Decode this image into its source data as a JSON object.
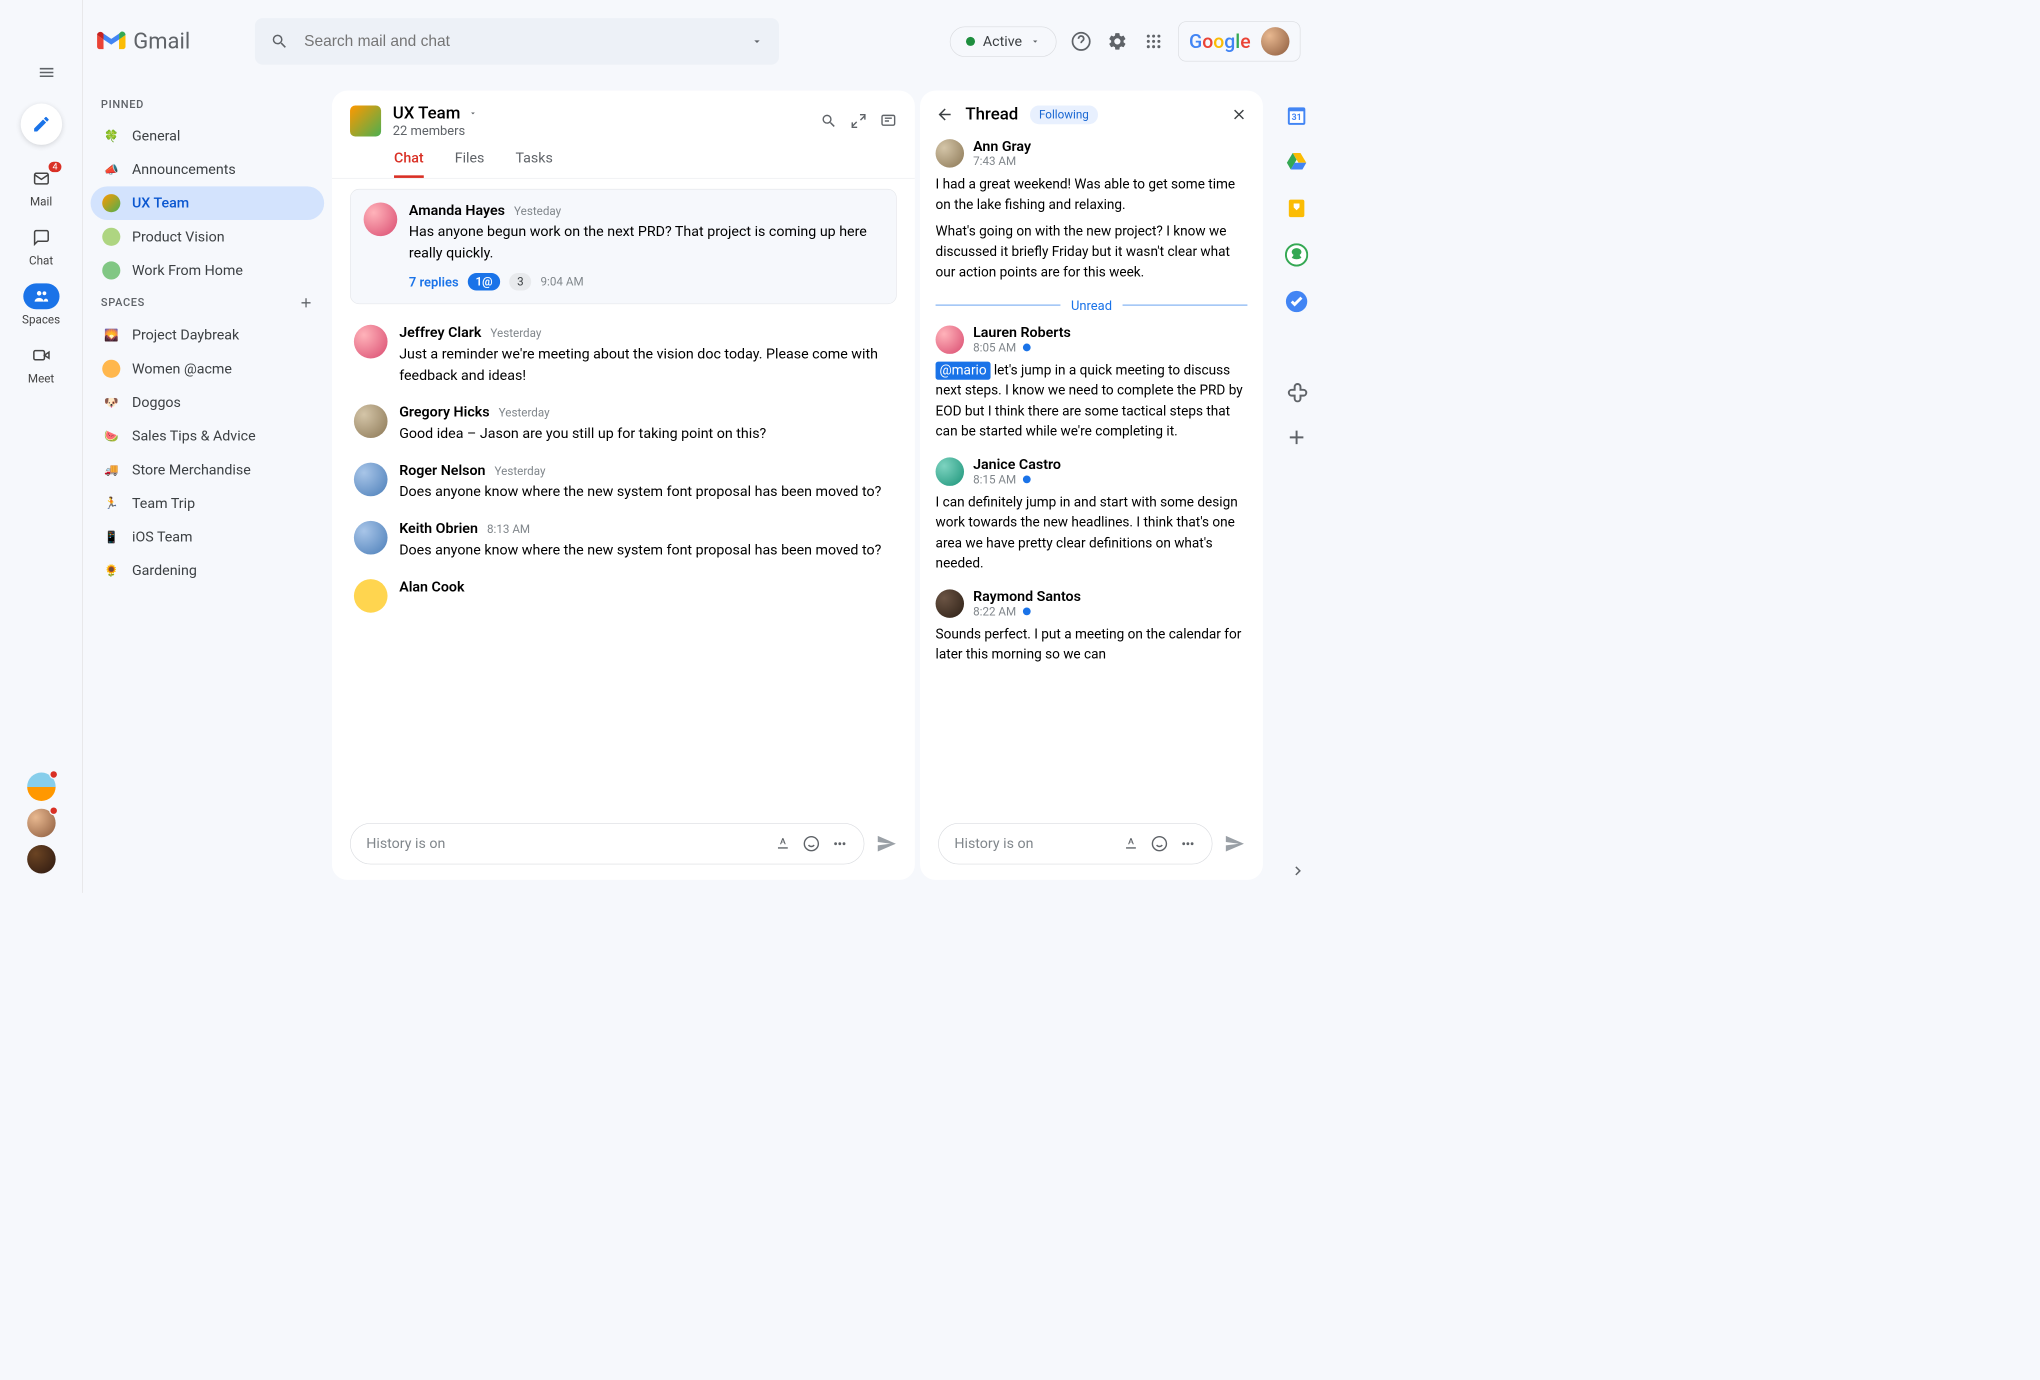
{
  "header": {
    "product": "Gmail",
    "search_placeholder": "Search mail and chat",
    "status_label": "Active",
    "google_text": "Google"
  },
  "rail": {
    "mail_label": "Mail",
    "mail_badge": "4",
    "chat_label": "Chat",
    "spaces_label": "Spaces",
    "meet_label": "Meet"
  },
  "sidebar": {
    "pinned_label": "PINNED",
    "spaces_label": "SPACES",
    "pinned": [
      {
        "icon": "🍀",
        "label": "General"
      },
      {
        "icon": "📣",
        "label": "Announcements"
      },
      {
        "icon": "",
        "label": "UX Team"
      },
      {
        "icon": "",
        "label": "Product Vision"
      },
      {
        "icon": "",
        "label": "Work From Home"
      }
    ],
    "spaces": [
      {
        "icon": "🌄",
        "label": "Project Daybreak"
      },
      {
        "icon": "",
        "label": "Women @acme"
      },
      {
        "icon": "🐶",
        "label": "Doggos"
      },
      {
        "icon": "🍉",
        "label": "Sales Tips & Advice"
      },
      {
        "icon": "🚚",
        "label": "Store Merchandise"
      },
      {
        "icon": "🏃",
        "label": "Team Trip"
      },
      {
        "icon": "📱",
        "label": "iOS Team"
      },
      {
        "icon": "🌻",
        "label": "Gardening"
      }
    ]
  },
  "space": {
    "name": "UX Team",
    "members": "22 members",
    "tab_chat": "Chat",
    "tab_files": "Files",
    "tab_tasks": "Tasks"
  },
  "messages": [
    {
      "name": "Amanda Hayes",
      "time": "Yesteday",
      "text": "Has anyone begun work on the next PRD? That project is coming up here really quickly.",
      "replies": "7 replies",
      "badge1": "1@",
      "badge2": "3",
      "reply_time": "9:04 AM"
    },
    {
      "name": "Jeffrey Clark",
      "time": "Yesterday",
      "text": "Just a reminder we're meeting about the vision doc today. Please come with feedback and ideas!"
    },
    {
      "name": "Gregory Hicks",
      "time": "Yesterday",
      "text": "Good idea – Jason are you still up for taking point on this?"
    },
    {
      "name": "Roger Nelson",
      "time": "Yesterday",
      "text": "Does anyone know where the new system font proposal has been moved to?"
    },
    {
      "name": "Keith Obrien",
      "time": "8:13 AM",
      "text": "Does anyone know where the new system font proposal has been moved to?"
    },
    {
      "name": "Alan Cook",
      "time": "",
      "text": ""
    }
  ],
  "compose": {
    "placeholder": "History is on"
  },
  "thread": {
    "title": "Thread",
    "following": "Following",
    "unread_label": "Unread",
    "messages": [
      {
        "name": "Ann Gray",
        "time": "7:43 AM",
        "text": "I had a great weekend! Was able to get some time on the lake fishing and relaxing.",
        "text2": "What's going on with the new project? I know we discussed it briefly Friday but it wasn't clear what our action points are for this week.",
        "unread": false
      },
      {
        "name": "Lauren Roberts",
        "time": "8:05 AM",
        "mention": "@mario",
        "text": " let's jump in a quick meeting to discuss next steps. I know we need to complete the PRD by EOD but I think there are some tactical steps that can be started while we're completing it.",
        "unread": true
      },
      {
        "name": "Janice Castro",
        "time": "8:15 AM",
        "text": "I can definitely jump in and start with some design work towards the new headlines. I think that's one area we have pretty clear definitions on what's needed.",
        "unread": true
      },
      {
        "name": "Raymond Santos",
        "time": "8:22 AM",
        "text": "Sounds perfect. I put a meeting on the calendar for later this morning so we can",
        "unread": true
      }
    ]
  }
}
